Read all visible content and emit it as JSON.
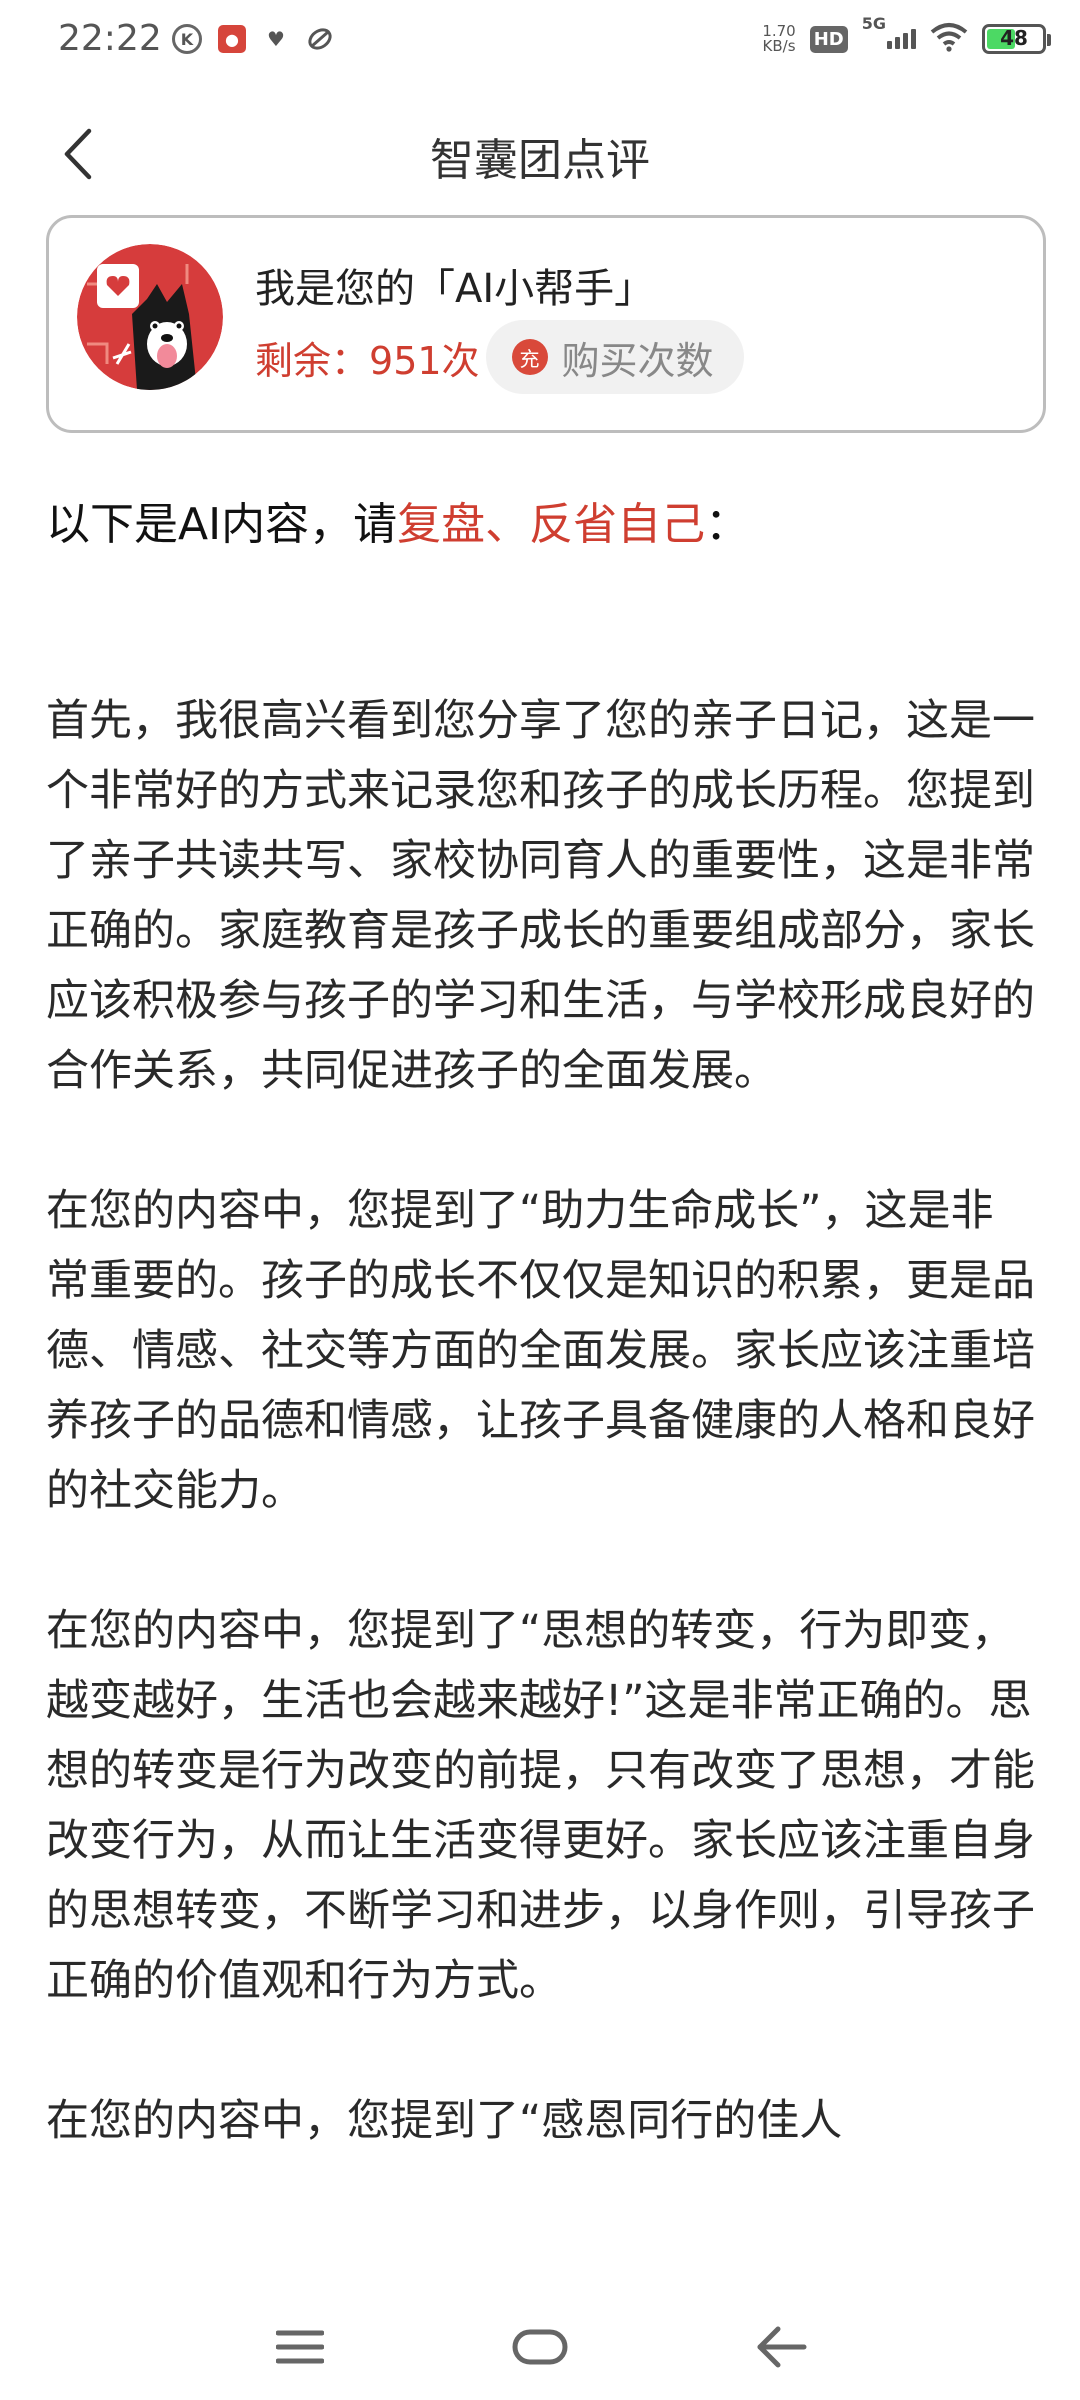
{
  "status_bar": {
    "time": "22:22",
    "net_speed_value": "1.70",
    "net_speed_unit": "KB/s",
    "hd_label": "HD",
    "network_label": "5G",
    "battery": "48",
    "battery_level": 0.48,
    "notification_icons": [
      "k-circle-icon",
      "app-red-icon",
      "heart-icon",
      "leaf-icon"
    ]
  },
  "header": {
    "title": "智囊团点评"
  },
  "card": {
    "title": "我是您的「AI小帮手」",
    "remaining_label": "剩余：",
    "remaining_count": "951次",
    "charge_icon_label": "充",
    "buy_label": "购买次数"
  },
  "notice": {
    "prefix": "以下是AI内容，请",
    "accent": "复盘、反省自己",
    "suffix": "："
  },
  "content": {
    "paragraphs": [
      "首先，我很高兴看到您分享了您的亲子日记，这是一个非常好的方式来记录您和孩子的成长历程。您提到了亲子共读共写、家校协同育人的重要性，这是非常正确的。家庭教育是孩子成长的重要组成部分，家长应该积极参与孩子的学习和生活，与学校形成良好的合作关系，共同促进孩子的全面发展。",
      "在您的内容中，您提到了“助力生命成长”，这是非常重要的。孩子的成长不仅仅是知识的积累，更是品德、情感、社交等方面的全面发展。家长应该注重培养孩子的品德和情感，让孩子具备健康的人格和良好的社交能力。",
      "在您的内容中，您提到了“思想的转变，行为即变，越变越好，生活也会越来越好!”这是非常正确的。思想的转变是行为改变的前提，只有改变了思想，才能改变行为，从而让生活变得更好。家长应该注重自身的思想转变，不断学习和进步，以身作则，引导孩子正确的价值观和行为方式。",
      "在您的内容中，您提到了“感恩同行的佳人"
    ]
  },
  "colors": {
    "accent": "#cf3e30",
    "text": "#2a2a2a",
    "card_border": "#bdbdbd"
  },
  "nav": {
    "icons": [
      "menu-icon",
      "home-icon",
      "back-icon"
    ]
  }
}
